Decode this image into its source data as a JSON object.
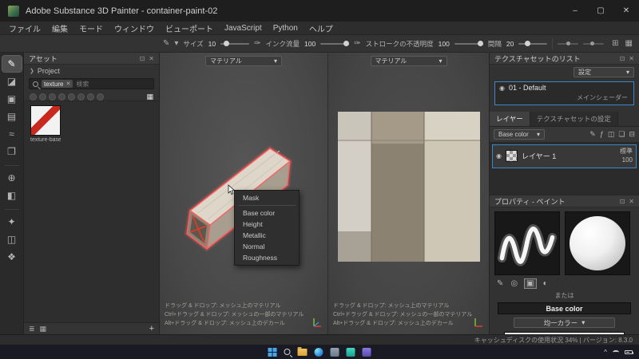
{
  "titlebar": {
    "title": "Adobe Substance 3D Painter - container-paint-02"
  },
  "menubar": {
    "items": [
      "ファイル",
      "編集",
      "モード",
      "ウィンドウ",
      "ビューポート",
      "JavaScript",
      "Python",
      "ヘルプ"
    ]
  },
  "toolbar": {
    "size_label": "サイズ",
    "size_value": "10",
    "flow_label": "インク流量",
    "flow_value": "100",
    "stroke_opacity_label": "ストロークの不透明度",
    "stroke_opacity_value": "100",
    "spacing_label": "間隔",
    "spacing_value": "20"
  },
  "assets": {
    "title": "アセット",
    "project_label": "Project",
    "search_chip": "texture",
    "search_placeholder": "検索",
    "item_caption": "texture-base"
  },
  "viewport3d": {
    "material_selector": "マテリアル",
    "context_menu_items": [
      "Mask",
      "Base color",
      "Height",
      "Metallic",
      "Normal",
      "Roughness"
    ],
    "help_lines": [
      "ドラッグ & ドロップ: メッシュ上のマテリアル",
      "Ctrl+ドラッグ & ドロップ: メッシュの一部のマテリアル",
      "Alt+ドラッグ & ドロップ: メッシュ上のデカール"
    ]
  },
  "viewport2d": {
    "material_selector": "マテリアル",
    "help_lines": [
      "ドラッグ & ドロップ: メッシュ上のマテリアル",
      "Ctrl+ドラッグ & ドロップ: メッシュの一部のマテリアル",
      "Alt+ドラッグ & ドロップ: メッシュ上のデカール"
    ]
  },
  "texture_sets": {
    "title": "テクスチャセットのリスト",
    "settings_button": "設定",
    "set_name": "01 - Default",
    "shader_name": "メインシェーダー"
  },
  "layers": {
    "tab_layers": "レイヤー",
    "tab_set_settings": "テクスチャセットの設定",
    "channel_selector": "Base color",
    "layer_name": "レイヤー 1",
    "blend_mode": "標準",
    "opacity": "100"
  },
  "properties": {
    "title": "プロパティ - ペイント",
    "or_label": "または",
    "channel_button": "Base color",
    "fill_button": "均一カラー"
  },
  "statusbar": {
    "text": "キャッシュディスクの使用状況  34% | バージョン: 8.3.0"
  },
  "colors": {
    "accent_blue": "#3f86c4",
    "highlight_red": "#ff5c5c"
  },
  "icons": {
    "minimize": "–",
    "maximize": "▢",
    "close": "✕",
    "float": "⊡",
    "chevron_down": "▾",
    "chevron_right": "❯",
    "eye": "◉",
    "grid": "▦",
    "grid2": "⊞",
    "list": "≣",
    "add": "+",
    "brush": "✎",
    "eraser": "◪",
    "projection": "▣",
    "polygon_fill": "▤",
    "smudge": "≈",
    "clone": "❐",
    "picker": "⊕",
    "mask": "◧",
    "mask2": "◫",
    "effect": "✦",
    "diamond": "❖",
    "fx": "ƒ",
    "folder": "❏",
    "trash": "⊟",
    "pen": "✑",
    "circle": "◎",
    "half_circle": "◐",
    "caret_up": "^"
  }
}
